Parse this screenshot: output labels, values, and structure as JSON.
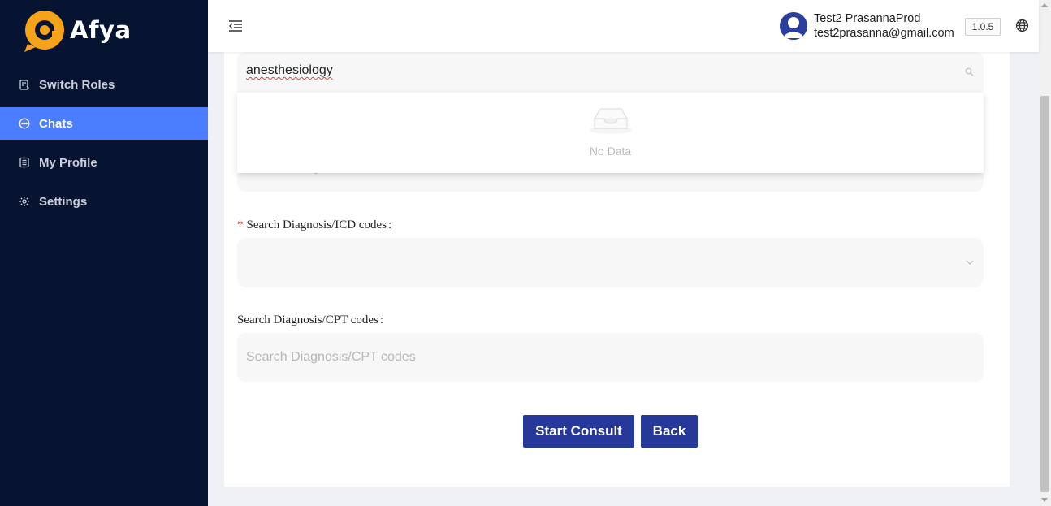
{
  "app": {
    "name": "Afya",
    "brand_orange": "#f7a21b",
    "brand_navy": "#061431",
    "accent": "#4a7dff"
  },
  "sidebar": {
    "items": [
      {
        "label": "Switch Roles",
        "icon": "switch-roles-icon",
        "active": false
      },
      {
        "label": "Chats",
        "icon": "chat-icon",
        "active": true
      },
      {
        "label": "My Profile",
        "icon": "profile-icon",
        "active": false
      },
      {
        "label": "Settings",
        "icon": "gear-icon",
        "active": false
      }
    ]
  },
  "header": {
    "user_name": "Test2 PrasannaProd",
    "user_email": "test2prasanna@gmail.com",
    "version": "1.0.5"
  },
  "form": {
    "search_value": "anesthesiology",
    "dropdown_empty_text": "No Data",
    "icd_label": "Search Diagnosis/ICD codes",
    "icd_required_mark": "*",
    "cpt_label": "Search Diagnosis/CPT codes",
    "cpt_placeholder": "Search Diagnosis/CPT codes",
    "label_colon": ":",
    "start_button": "Start Consult",
    "back_button": "Back"
  }
}
